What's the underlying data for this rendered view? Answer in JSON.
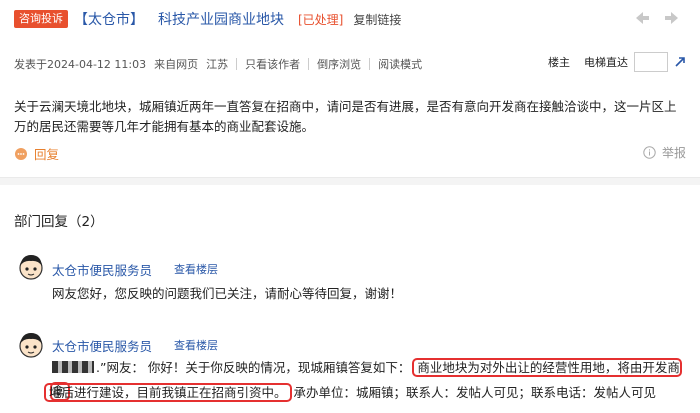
{
  "header": {
    "tag": "咨询投诉",
    "city": "【太仓市】",
    "title": "科技产业园商业地块",
    "status": "[已处理]",
    "copy_link": "复制链接"
  },
  "meta": {
    "posted": "发表于2024-04-12 11:03",
    "source": "来自网页",
    "region": "江苏",
    "only_author": "只看该作者",
    "reverse": "倒序浏览",
    "read_mode": "阅读模式",
    "floor_owner": "楼主",
    "floor_jump": "电梯直达",
    "floor_input_value": ""
  },
  "post": {
    "content": "关于云澜天境北地块，城厢镇近两年一直答复在招商中，请问是否有进展，是否有意向开发商在接触洽谈中，这一片区上万的居民还需要等几年才能拥有基本的商业配套设施。",
    "reply_label": "回复",
    "report_label": "举报"
  },
  "replies_section": {
    "title": "部门回复（2）",
    "items": [
      {
        "name": "太仓市便民服务员",
        "floor_link": "查看楼层",
        "text": "网友您好，您反映的问题我们已关注，请耐心等待回复，谢谢！"
      },
      {
        "name": "太仓市便民服务员",
        "floor_link": "查看楼层",
        "prefix": ".”网友：  你好！关于你反映的情况，现城厢镇答复如下：",
        "highlight1": "商业地块为对外出让的经营性用地，将由开发商拿",
        "highlight2": "地后进行建设，目前我镇正在招商引资中。",
        "suffix": "承办单位：城厢镇；联系人：发帖人可见；联系电话：发帖人可见"
      }
    ]
  },
  "colors": {
    "accent": "#e8502e",
    "link": "#2a58a8",
    "highlight": "#e53030"
  }
}
